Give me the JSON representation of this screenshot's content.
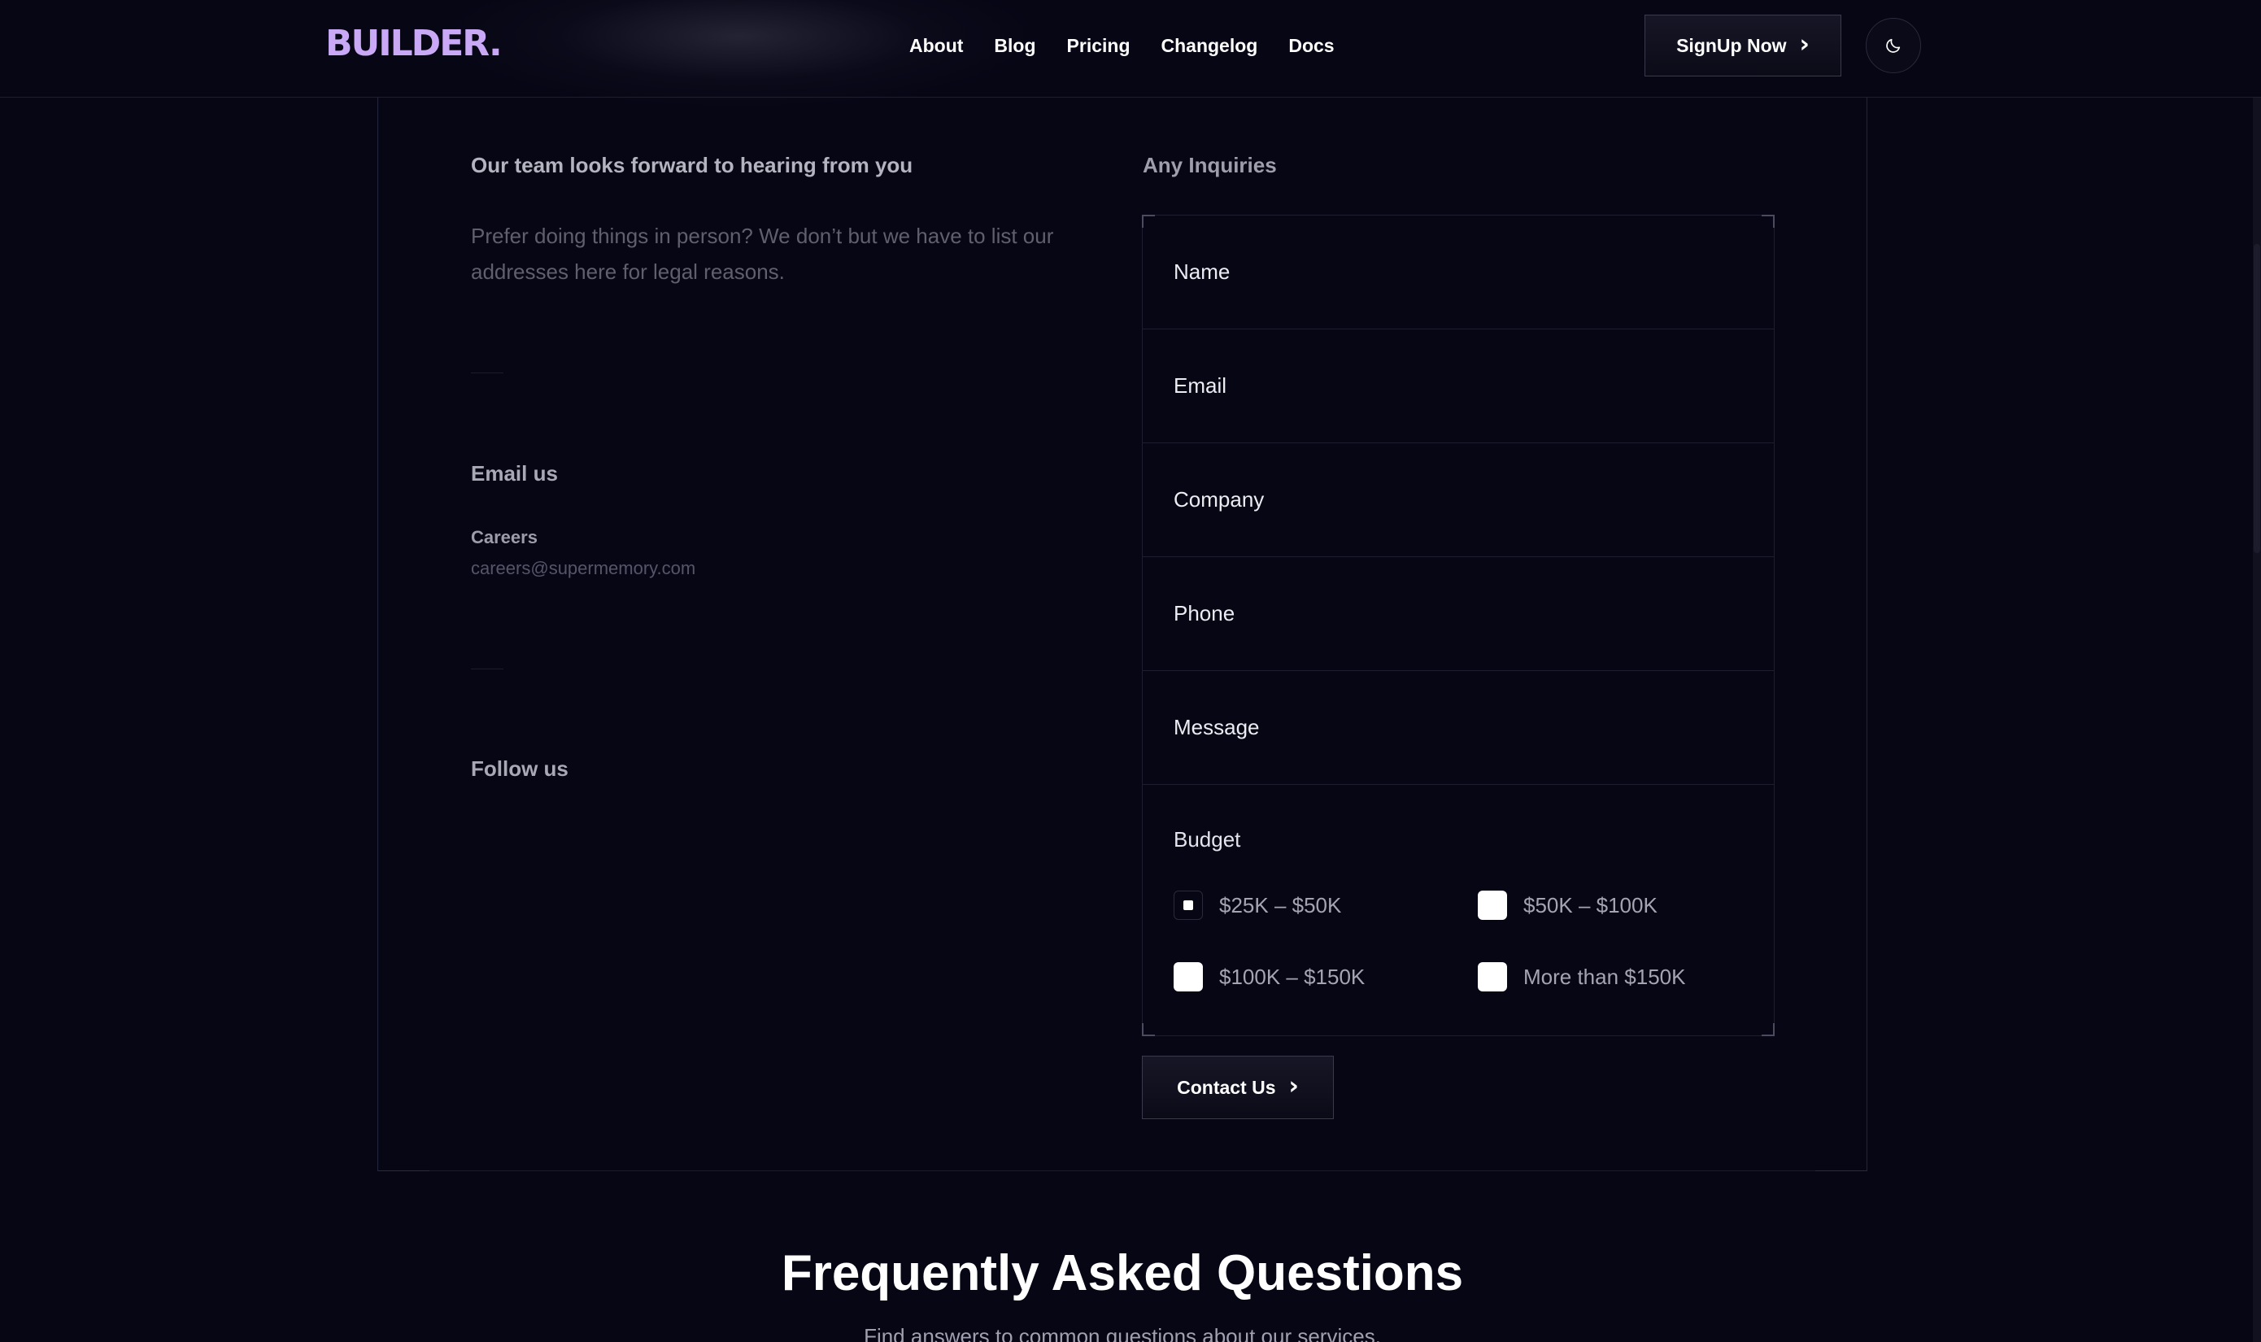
{
  "header": {
    "logo": "BUILDER.",
    "nav": [
      "About",
      "Blog",
      "Pricing",
      "Changelog",
      "Docs"
    ],
    "signup_label": "SignUp Now",
    "theme_toggle_icon": "moon-icon"
  },
  "contact": {
    "heading": "Our team looks forward to hearing from you",
    "lead": "Prefer doing things in person? We don’t but we have to list our addresses here for legal reasons.",
    "email_section_title": "Email us",
    "careers_label": "Careers",
    "careers_email": "careers@supermemory.com",
    "follow_title": "Follow us"
  },
  "form": {
    "title": "Any Inquiries",
    "fields": [
      {
        "placeholder": "Name",
        "value": ""
      },
      {
        "placeholder": "Email",
        "value": ""
      },
      {
        "placeholder": "Company",
        "value": ""
      },
      {
        "placeholder": "Phone",
        "value": ""
      },
      {
        "placeholder": "Message",
        "value": ""
      }
    ],
    "budget_label": "Budget",
    "budget_options": [
      {
        "label": "$25K – $50K",
        "selected": true
      },
      {
        "label": "$50K – $100K",
        "selected": false
      },
      {
        "label": "$100K – $150K",
        "selected": false
      },
      {
        "label": "More than $150K",
        "selected": false
      }
    ],
    "submit_label": "Contact Us"
  },
  "faq": {
    "title": "Frequently Asked Questions",
    "subtitle": "Find answers to common questions about our services."
  },
  "colors": {
    "background": "#060615",
    "logo": "#c9a9f5",
    "border": "#1e1e30"
  }
}
